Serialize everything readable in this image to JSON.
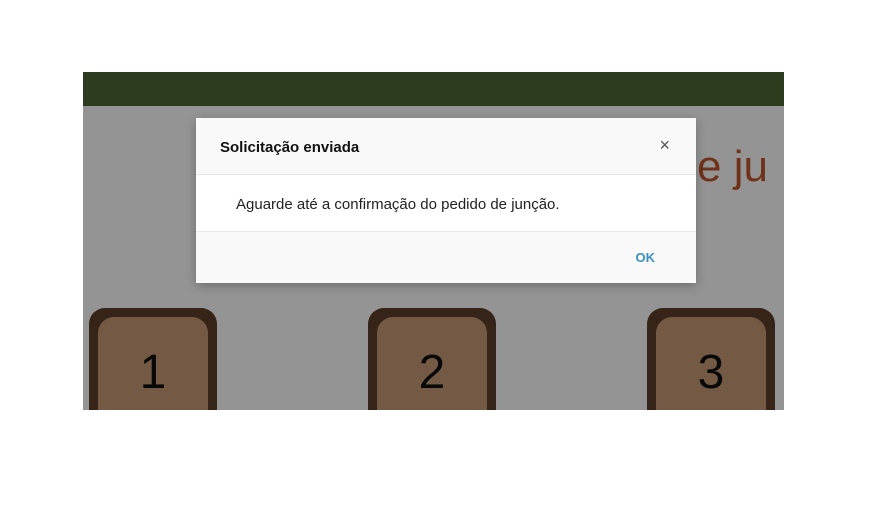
{
  "page": {
    "heading": "e ju",
    "tiles": [
      "1",
      "2",
      "3"
    ]
  },
  "dialog": {
    "title": "Solicitação enviada",
    "close_icon": "×",
    "message": "Aguarde até a confirmação do pedido de junção.",
    "ok_label": "OK"
  },
  "colors": {
    "header": "#4e6634",
    "heading_text": "#c0582f",
    "tile_border": "#5e3f2a",
    "tile_fill": "#c89c77",
    "ok_text": "#3a8fc4"
  }
}
